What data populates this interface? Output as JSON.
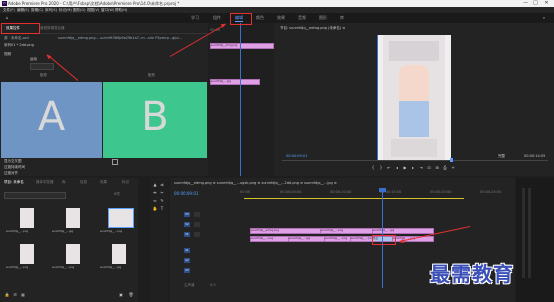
{
  "window": {
    "title": "Adobe Premiere Pro 2020 - C:\\用户\\Fsbsp\\文档\\Adobe\\Premiere Pro\\14.0\\未命名.prproj *",
    "app_badge": "Pr",
    "controls": [
      "—",
      "□",
      "✕"
    ]
  },
  "menubar": [
    "文件(F)",
    "编辑(E)",
    "剪辑(C)",
    "序列(S)",
    "标记(M)",
    "图形(G)",
    "视图(V)",
    "窗口(W)",
    "帮助(H)"
  ],
  "workspaces": [
    "学习",
    "组件",
    "编辑",
    "颜色",
    "效果",
    "音频",
    "图形",
    "库"
  ],
  "active_workspace": "编辑",
  "effect_controls": {
    "tabs": [
      "效果控件",
      "音频剪辑混合器"
    ],
    "source_label": "源 · 未命名.psd",
    "sequence_label": "序列01 * 2dd.png",
    "clip_name": "sunmfdjq__edmg.png... uuim9t38lfp9a29b1a7..m...slm  F5pmrp...glpl...",
    "effect_row1": "视频",
    "effect_row2": "运动",
    "panel_label_a": "A",
    "panel_label_b": "B",
    "label_a_caption": "矩形",
    "label_b_caption": "矩形",
    "bottom_rows": [
      "显示交叉图",
      "过渡持续时间",
      "过渡对齐"
    ],
    "timecode": "00:00:09:01"
  },
  "mini_timeline": {
    "clip_top": "sunmfdjq__dmg.png",
    "clip_bottom": "sunmfdjq_...jpg",
    "ruler_label": "00:00"
  },
  "program_monitor": {
    "title": "节目: sunmfdjq__edmg.png (未命名)  ≡",
    "timecode_left": "00:00:09:01",
    "fit": "完整",
    "timecode_right": "00:00:14:05",
    "zoom": "适合"
  },
  "project_panel": {
    "tabs": [
      "项目: 未命名",
      "媒体浏览器",
      "库",
      "信息",
      "效果",
      "标记"
    ],
    "search_placeholder": "",
    "item_count": "6项",
    "items": [
      {
        "caption": "sunmfdjq__...png"
      },
      {
        "caption": "sunmfdjq__...jpg"
      },
      {
        "caption": "sunmfdjq__...png"
      },
      {
        "caption": "sunmfdjq__...png"
      },
      {
        "caption": "sunmfdjq__...png"
      },
      {
        "caption": "sunmfdjq__...jpg"
      }
    ]
  },
  "timeline": {
    "title": "sunmfdjq__edmg.png  ≡  sunmfdjq__...ugxk.png  ≡  sunmfdjq__...2dd.png  ≡  sunmfdjq__...jpg  ≡",
    "timecode": "00:00:09:01",
    "ruler_ticks": [
      "00:00",
      "00:00:05:00",
      "00:00:10:00",
      "00:00:15:00",
      "00:00:20:00",
      "00:00:25:00"
    ],
    "tracks": [
      "V3",
      "V2",
      "V1",
      "A1",
      "A2",
      "A3"
    ],
    "master": "主声道",
    "master_value": "0.0",
    "clips_v2": [
      "sunmfdjq__edmg.png",
      "sunmfdjq__...png",
      "sunmfdjq__...jpg"
    ],
    "clips_v1": [
      "sunmfdjq__...png",
      "sunmfdjq__...jpg",
      "sunmfdjq__...png",
      "sunmfdjq__...png",
      "交叉",
      "sunmfdjq__...png"
    ]
  },
  "watermark": "最需教育",
  "colors": {
    "accent": "#5aa0ff",
    "clip": "#e0a0e6",
    "annotation": "#e53030",
    "panel_a": "#6f95c4",
    "panel_b": "#3dc68d"
  }
}
